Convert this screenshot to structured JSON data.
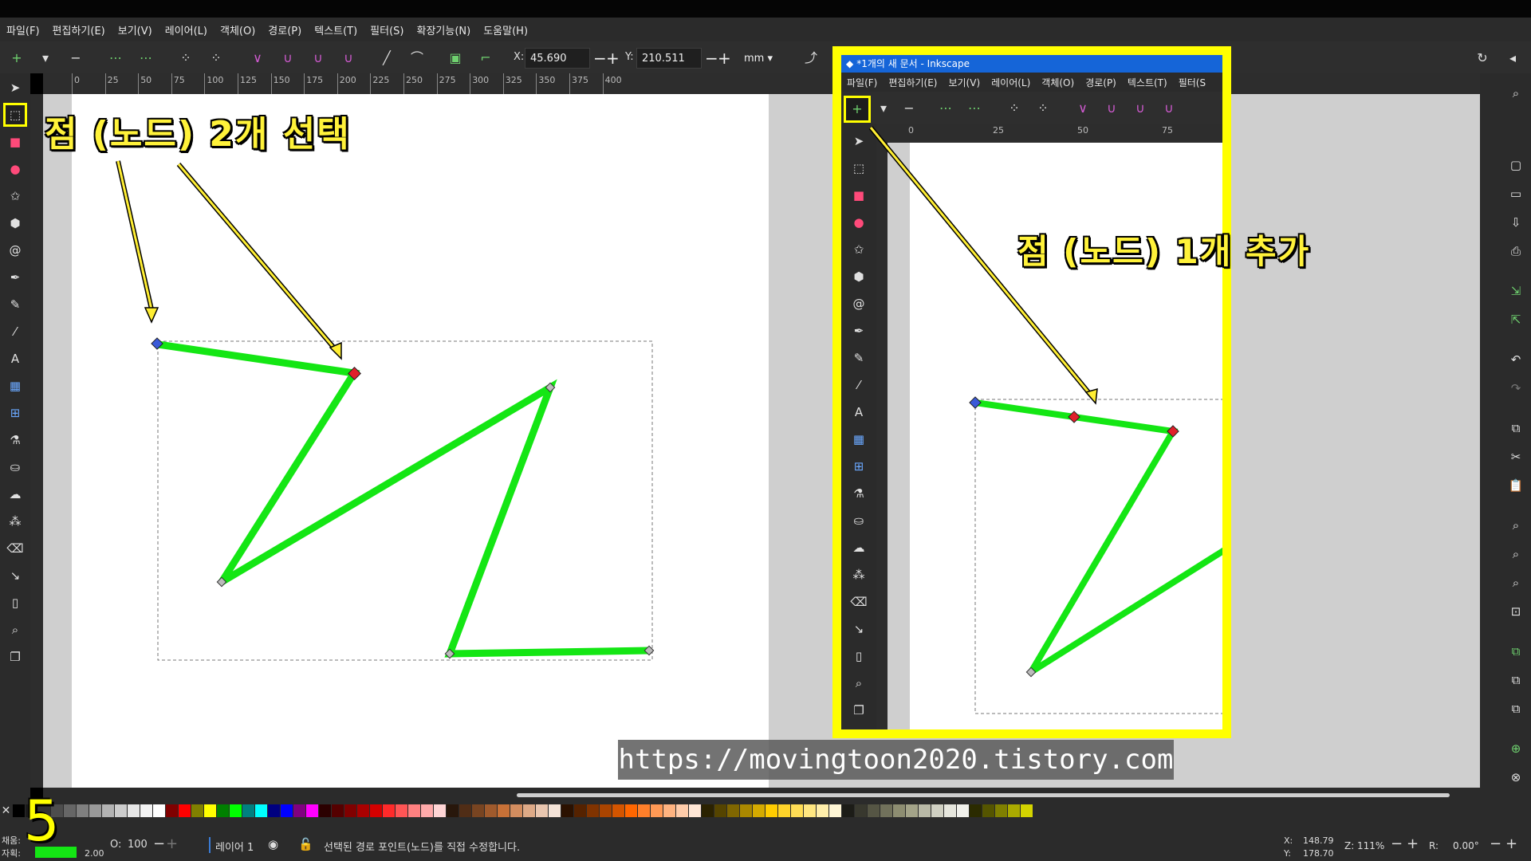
{
  "menu": [
    "파일(F)",
    "편집하기(E)",
    "보기(V)",
    "레이어(L)",
    "객체(O)",
    "경로(P)",
    "텍스트(T)",
    "필터(S)",
    "확장기능(N)",
    "도움말(H)"
  ],
  "toolbar": {
    "x_label": "X:",
    "x_value": "45.690",
    "y_label": "Y:",
    "y_value": "210.511",
    "unit": "mm"
  },
  "ruler_top_labels": [
    "0",
    "25",
    "50",
    "75",
    "100",
    "125",
    "150",
    "175",
    "200",
    "225",
    "250",
    "275",
    "300",
    "325",
    "350",
    "375",
    "400"
  ],
  "annotations": {
    "left": "점 (노드) 2개 선택",
    "right": "점 (노드) 1개 추가",
    "url": "https://movingtoon2020.tistory.com",
    "step": "5"
  },
  "inset": {
    "title": "*1개의 새 문서 - Inkscape",
    "menu": [
      "파일(F)",
      "편집하기(E)",
      "보기(V)",
      "레이어(L)",
      "객체(O)",
      "경로(P)",
      "텍스트(T)",
      "필터(S"
    ],
    "ruler_labels": [
      "0",
      "25",
      "50",
      "75"
    ]
  },
  "status": {
    "fill_label": "채움:",
    "stroke_label": "자획:",
    "stroke_width": "2.00",
    "opacity_label": "O:",
    "opacity_value": "100",
    "layer": "레이어 1",
    "message": "선택된 경로 포인트(노드)를 직접 수정합니다.",
    "cursor_x_label": "X:",
    "cursor_x": "148.79",
    "cursor_y_label": "Y:",
    "cursor_y": "178.70",
    "zoom_label": "Z:",
    "zoom": "111%",
    "rotate_label": "R:",
    "rotate": "0.00°"
  },
  "colors": {
    "path": "#14e614",
    "selected_node": "#e0202a",
    "accent": "#ffff00"
  }
}
